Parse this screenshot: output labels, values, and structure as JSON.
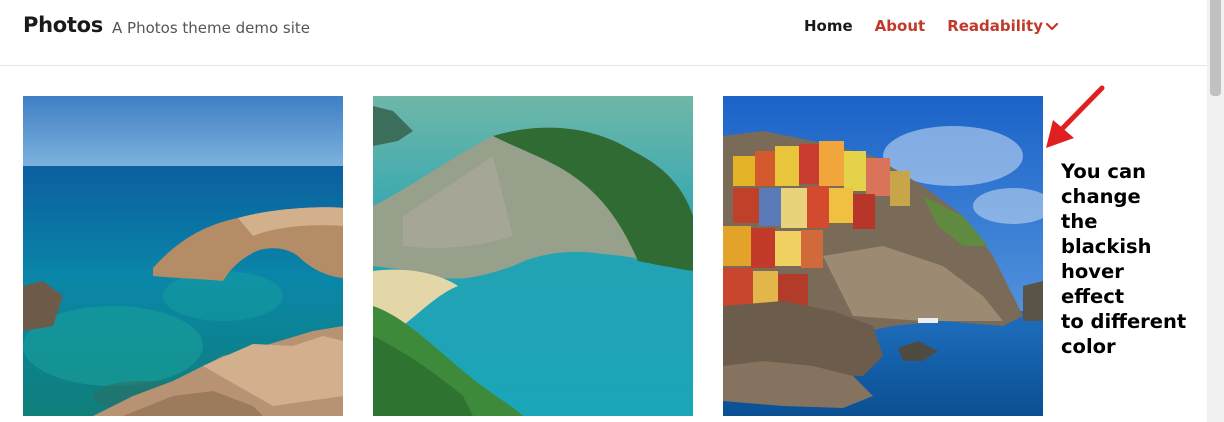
{
  "header": {
    "site_title": "Photos",
    "site_description": "A Photos theme demo site"
  },
  "nav": {
    "items": [
      {
        "label": "Home"
      },
      {
        "label": "About"
      },
      {
        "label": "Readability"
      }
    ]
  },
  "gallery": {
    "photos": [
      {
        "subject": "rocky-sea-arch-coast"
      },
      {
        "subject": "cliff-bay-beach"
      },
      {
        "subject": "colorful-cliff-village"
      }
    ]
  },
  "annotation": {
    "lines": [
      "You can",
      "change",
      "the",
      "blackish",
      "hover",
      "effect",
      "to different",
      "color"
    ],
    "arrow_color": "#e02020"
  },
  "colors": {
    "accent": "#c0392b",
    "text": "#1a1a1a"
  }
}
